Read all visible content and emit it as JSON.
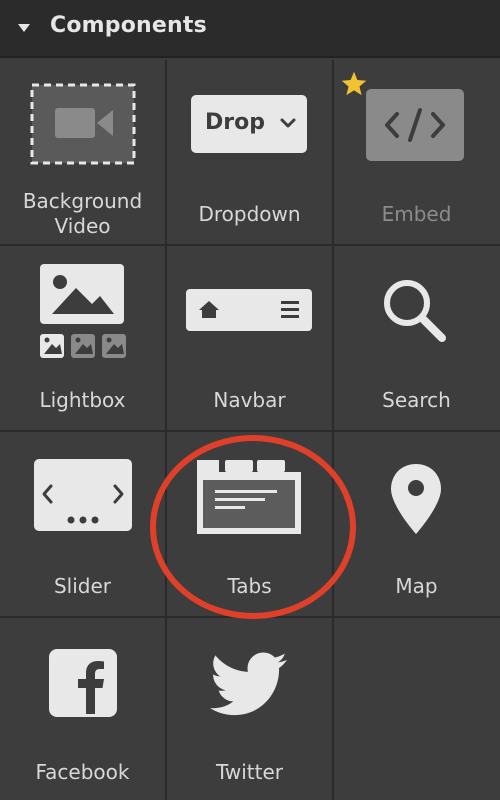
{
  "panel": {
    "title": "Components"
  },
  "components": [
    {
      "label": "Background Video",
      "icon": "video-icon",
      "dim": false
    },
    {
      "label": "Dropdown",
      "icon": "dropdown-icon",
      "icon_text": "Drop",
      "dim": false
    },
    {
      "label": "Embed",
      "icon": "code-icon",
      "dim": true,
      "starred": true
    },
    {
      "label": "Lightbox",
      "icon": "image-icon",
      "dim": false
    },
    {
      "label": "Navbar",
      "icon": "navbar-icon",
      "dim": false
    },
    {
      "label": "Search",
      "icon": "search-icon",
      "dim": false
    },
    {
      "label": "Slider",
      "icon": "slider-icon",
      "dim": false
    },
    {
      "label": "Tabs",
      "icon": "tabs-icon",
      "dim": false,
      "highlighted": true
    },
    {
      "label": "Map",
      "icon": "map-pin-icon",
      "dim": false
    },
    {
      "label": "Facebook",
      "icon": "facebook-icon",
      "dim": false
    },
    {
      "label": "Twitter",
      "icon": "twitter-icon",
      "dim": false
    }
  ],
  "colors": {
    "highlight": "#e0402a",
    "star": "#f2c230",
    "icon_light": "#e8e8e8",
    "icon_dark": "#5c5c5c"
  }
}
